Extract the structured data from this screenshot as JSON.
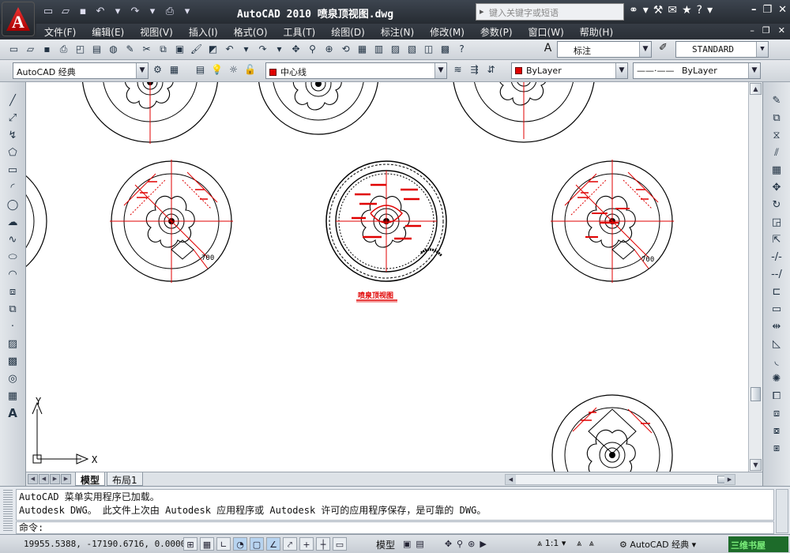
{
  "app": {
    "title": "AutoCAD 2010  喷泉顶视图.dwg",
    "search_placeholder": "键入关键字或短语"
  },
  "menu": {
    "items": [
      "文件(F)",
      "编辑(E)",
      "视图(V)",
      "插入(I)",
      "格式(O)",
      "工具(T)",
      "绘图(D)",
      "标注(N)",
      "修改(M)",
      "参数(P)",
      "窗口(W)",
      "帮助(H)"
    ]
  },
  "toolbar": {
    "dim_style": "标注",
    "text_style": "STANDARD",
    "workspace": "AutoCAD 经典",
    "layer": "中心线",
    "color": "ByLayer",
    "linetype": "ByLayer"
  },
  "drawing": {
    "view_title": "喷泉顶视图",
    "dim_label": "700",
    "ucs_x": "X",
    "ucs_y": "Y"
  },
  "tabs": {
    "model": "模型",
    "layout1": "布局1"
  },
  "command": {
    "history": [
      "AutoCAD 菜单实用程序已加载。",
      "Autodesk DWG。  此文件上次由 Autodesk 应用程序或 Autodesk 许可的应用程序保存，是可靠的 DWG。"
    ],
    "prompt": "命令:"
  },
  "status": {
    "coords": "19955.5388, -17190.6716, 0.0000",
    "model_label": "模型",
    "scale": "1:1",
    "workspace": "AutoCAD 经典",
    "watermark": "三维书屋"
  },
  "colors": {
    "accent_red": "#e00000",
    "titlebar": "#2b3038"
  }
}
